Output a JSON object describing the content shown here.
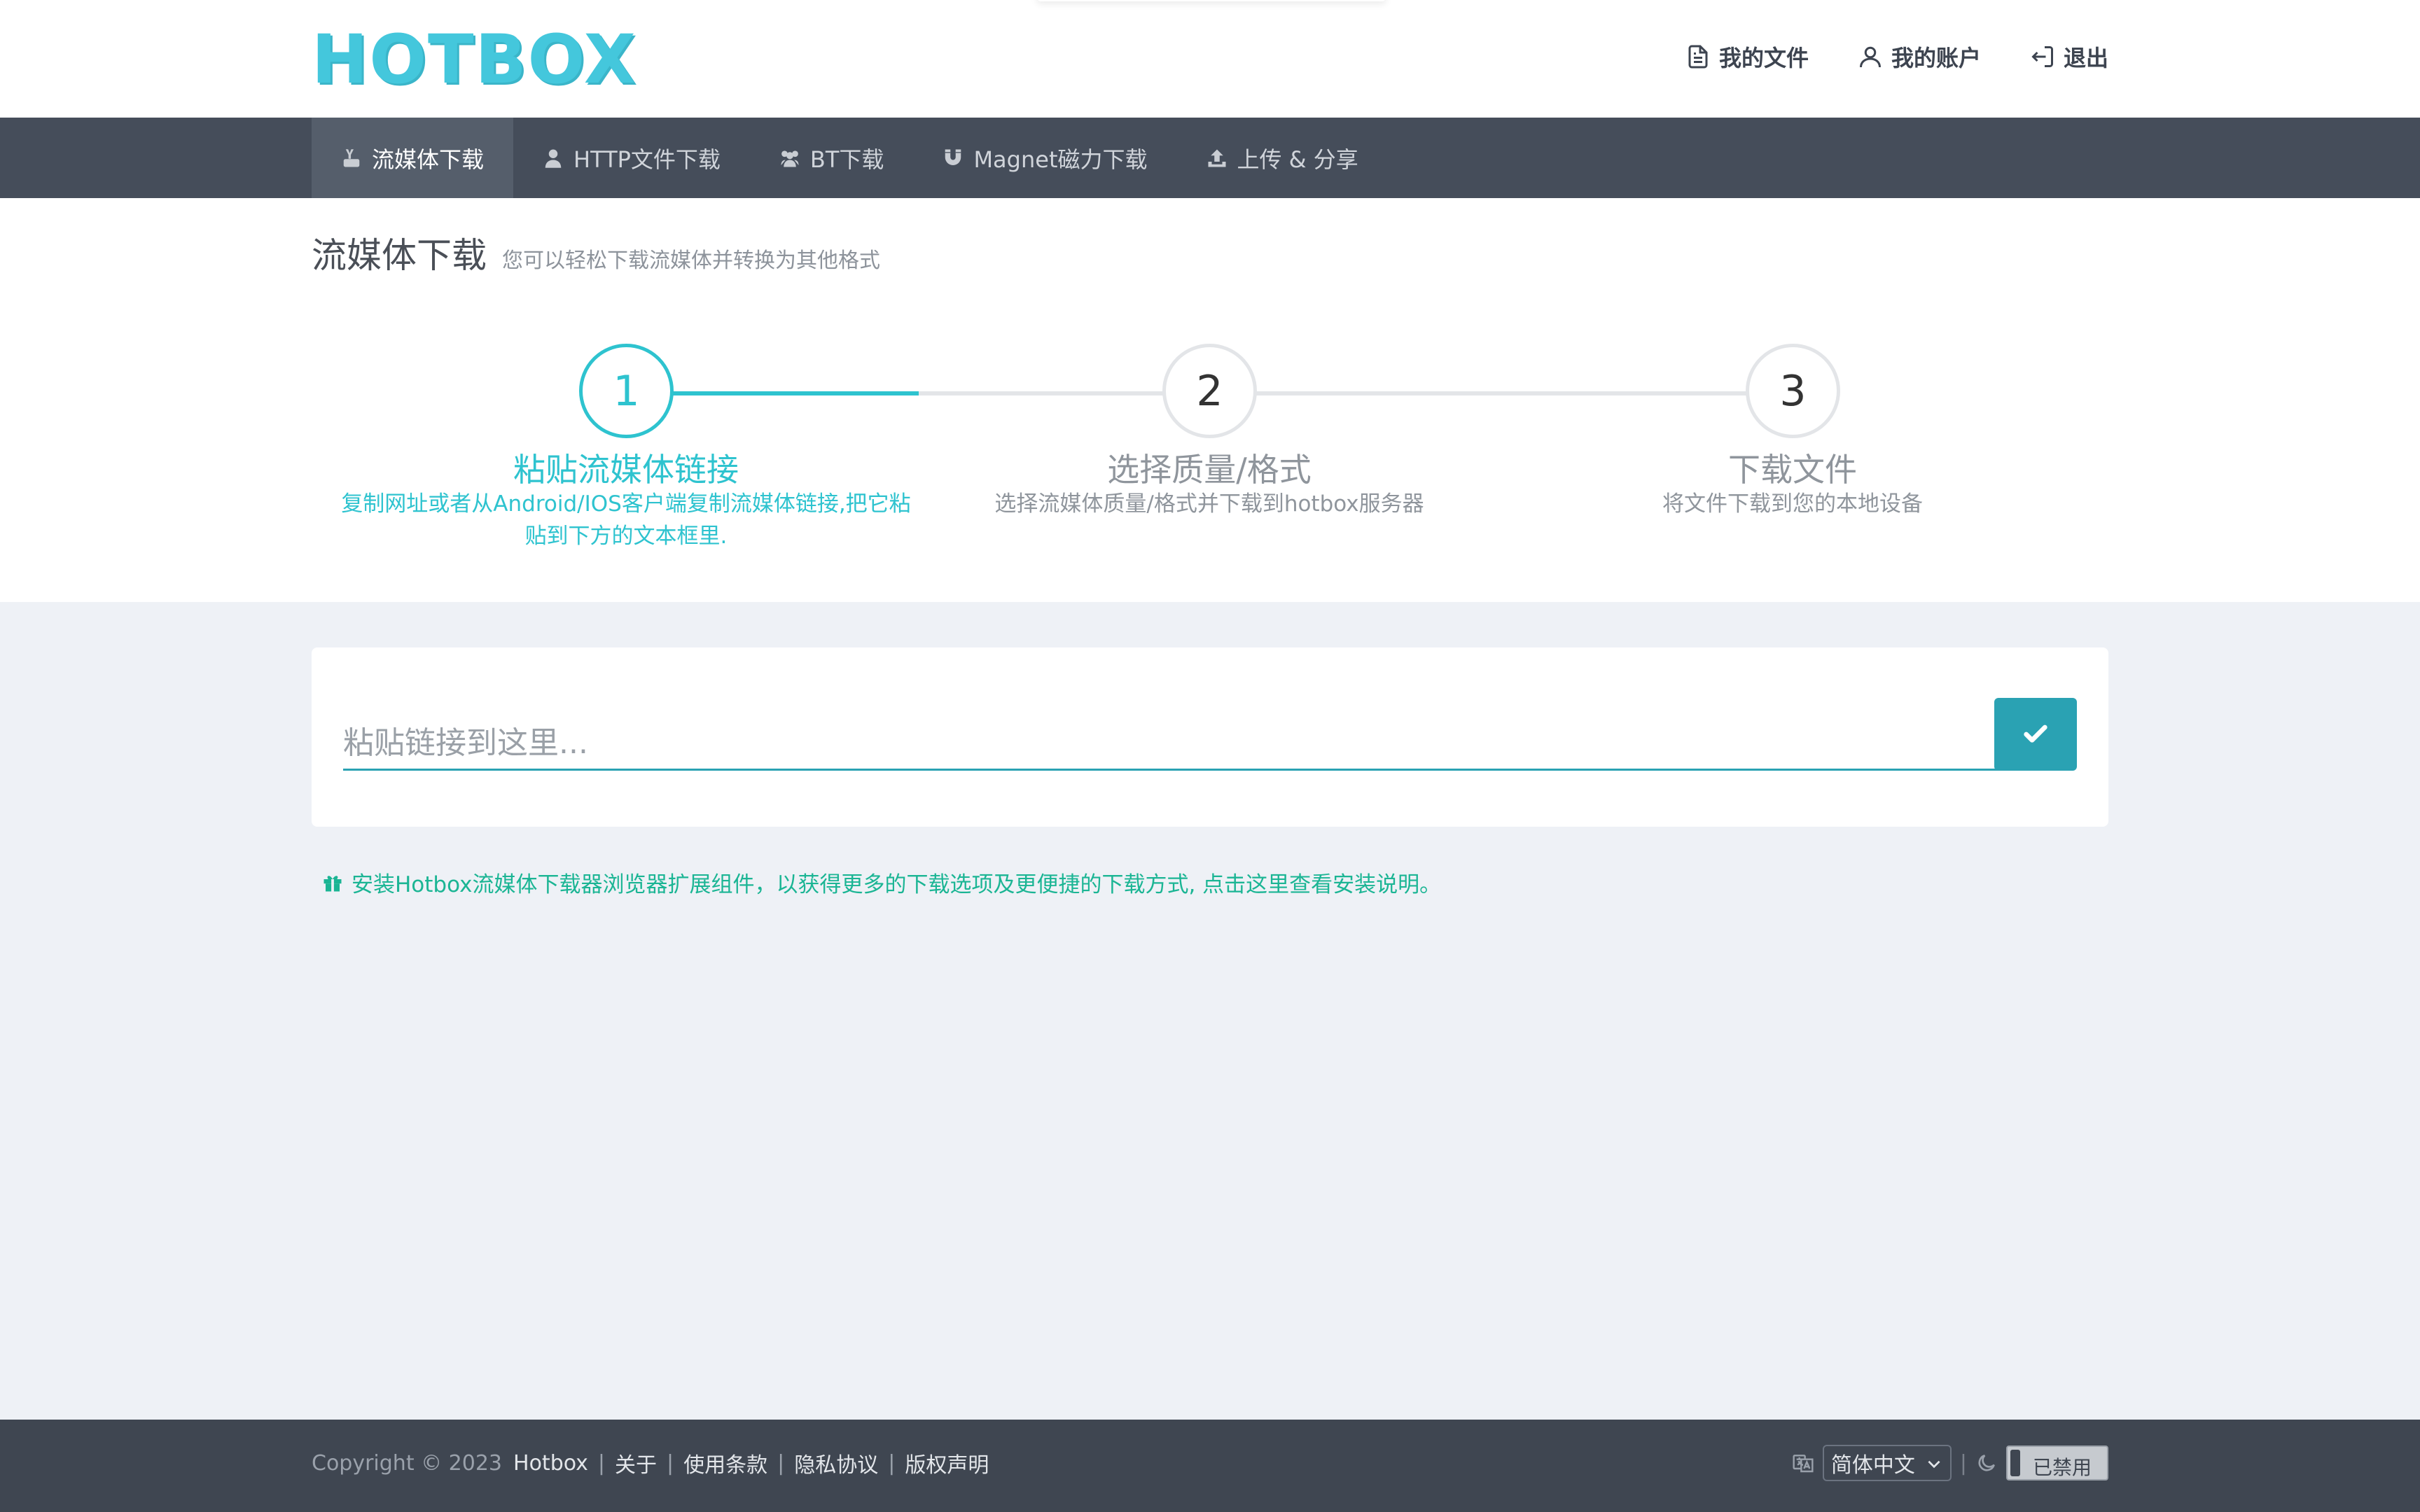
{
  "header": {
    "logo": "HOTBOX",
    "user_nav": [
      {
        "label": "我的文件",
        "icon": "file-icon"
      },
      {
        "label": "我的账户",
        "icon": "user-icon"
      },
      {
        "label": "退出",
        "icon": "logout-icon"
      }
    ]
  },
  "nav": {
    "tabs": [
      {
        "label": "流媒体下载",
        "icon": "youtube-icon",
        "active": true
      },
      {
        "label": "HTTP文件下载",
        "icon": "user-icon"
      },
      {
        "label": "BT下载",
        "icon": "users-icon"
      },
      {
        "label": "Magnet磁力下载",
        "icon": "magnet-icon"
      },
      {
        "label": "上传 & 分享",
        "icon": "upload-icon"
      }
    ]
  },
  "page": {
    "title": "流媒体下载",
    "subtitle": "您可以轻松下载流媒体并转换为其他格式"
  },
  "steps": [
    {
      "number": "1",
      "title": "粘贴流媒体链接",
      "desc_line1": "复制网址或者从Android/IOS客户端复制流媒体链接,把它粘",
      "desc_line2": "贴到下方的文本框里.",
      "active": true
    },
    {
      "number": "2",
      "title": "选择质量/格式",
      "desc_line1": "选择流媒体质量/格式并下载到hotbox服务器",
      "desc_line2": ""
    },
    {
      "number": "3",
      "title": "下载文件",
      "desc_line1": "将文件下载到您的本地设备",
      "desc_line2": ""
    }
  ],
  "input": {
    "placeholder": "粘贴链接到这里...",
    "value": ""
  },
  "promo": {
    "text": "安装Hotbox流媒体下载器浏览器扩展组件，以获得更多的下载选项及更便捷的下载方式, 点击这里查看安装说明。"
  },
  "footer": {
    "copyright": "Copyright © 2023",
    "brand": "Hotbox",
    "links": [
      "关于",
      "使用条款",
      "隐私协议",
      "版权声明"
    ],
    "language": "简体中文",
    "dark_mode_label": "已禁用"
  },
  "colors": {
    "accent": "#2ec3cf",
    "nav_bg": "#454d5a",
    "footer_bg": "#3f4651",
    "promo_green": "#1bb594",
    "button": "#2aa2b3"
  }
}
